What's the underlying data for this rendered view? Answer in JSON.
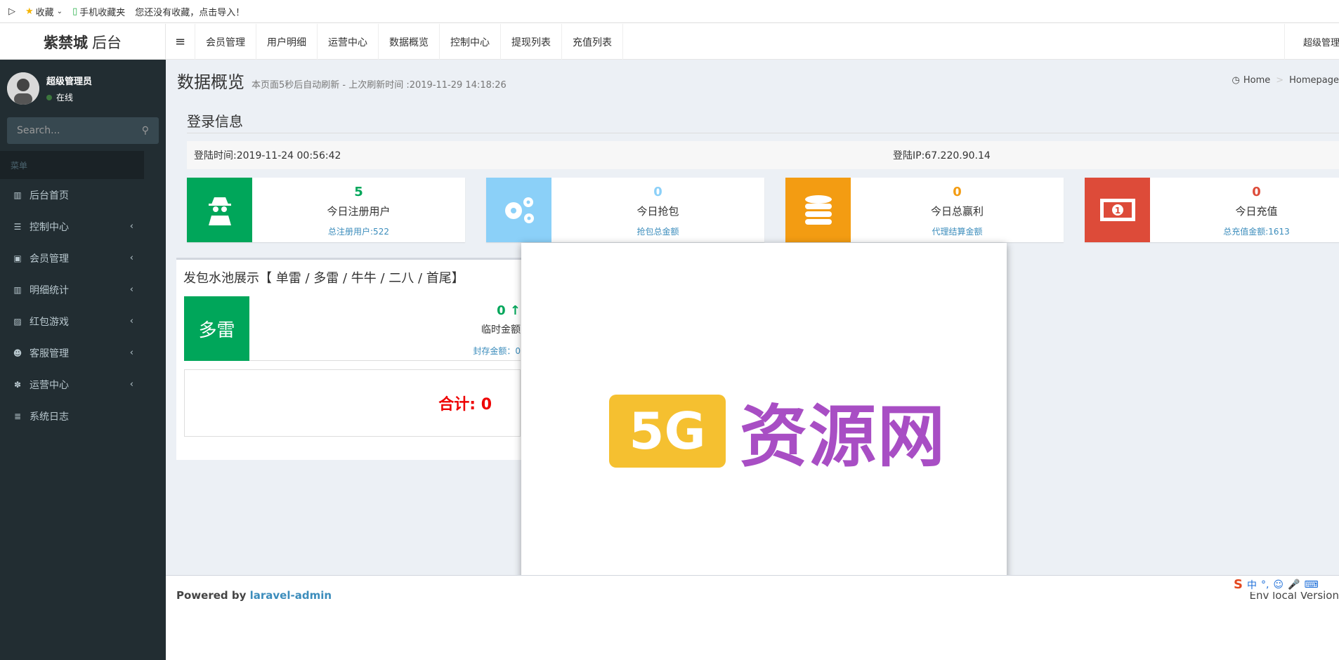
{
  "bookmarks": {
    "favorites": "收藏",
    "mobile": "手机收藏夹",
    "hint": "您还没有收藏，点击导入！"
  },
  "header": {
    "logo_bold": "紫禁城",
    "logo_rest": "后台",
    "nav": [
      "会员管理",
      "用户明细",
      "运营中心",
      "数据概览",
      "控制中心",
      "提现列表",
      "充值列表"
    ],
    "user": "超级管理员"
  },
  "sidebar": {
    "user_name": "超级管理员",
    "status": "在线",
    "search_placeholder": "Search...",
    "menu_header": "菜单",
    "items": [
      {
        "label": "后台首页",
        "icon": "bar-chart-icon"
      },
      {
        "label": "控制中心",
        "icon": "list-icon"
      },
      {
        "label": "会员管理",
        "icon": "user-box-icon"
      },
      {
        "label": "明细统计",
        "icon": "bar-chart-icon"
      },
      {
        "label": "红包游戏",
        "icon": "image-icon"
      },
      {
        "label": "客服管理",
        "icon": "users-icon"
      },
      {
        "label": "运营中心",
        "icon": "bug-icon"
      },
      {
        "label": "系统日志",
        "icon": "database-icon"
      }
    ]
  },
  "page": {
    "title": "数据概览",
    "subtitle": "本页面5秒后自动刷新 - 上次刷新时间 :2019-11-29 14:18:26",
    "breadcrumb_home": "Home",
    "breadcrumb_current": "Homepage"
  },
  "login": {
    "section": "登录信息",
    "time": "登陆时间:2019-11-24 00:56:42",
    "ip": "登陆IP:67.220.90.14"
  },
  "stats": [
    {
      "value": "5",
      "label": "今日注册用户",
      "sub": "总注册用户:522",
      "color": "#00a65a"
    },
    {
      "value": "0",
      "label": "今日抢包",
      "sub": "抢包总金额",
      "color": "#8bd0f8"
    },
    {
      "value": "0",
      "label": "今日总赢利",
      "sub": "代理结算金额",
      "color": "#f39c12"
    },
    {
      "value": "0",
      "label": "今日充值",
      "sub": "总充值金额:1613",
      "color": "#dd4b39"
    }
  ],
  "pool": {
    "title": "发包水池展示【 单雷 / 多雷 / 牛牛 / 二八 / 首尾】",
    "tag": "多雷",
    "value": "0 ↑",
    "label": "临时金额",
    "sub": "封存金额：0",
    "total": "合计:  0"
  },
  "watermark": {
    "badge": "5G",
    "text": "资源网"
  },
  "footer": {
    "powered": "Powered by ",
    "link": "laravel-admin",
    "env": "Env  local   Version"
  },
  "ime": {
    "items": [
      "中",
      "°,",
      "☺",
      "🎤",
      "⌨"
    ]
  }
}
